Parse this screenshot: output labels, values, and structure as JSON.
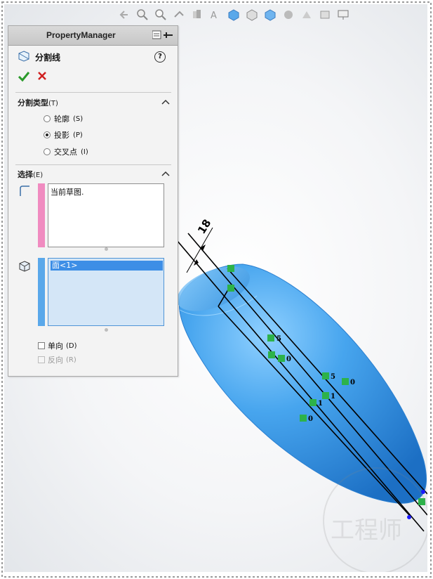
{
  "property_manager": {
    "title": "PropertyManager",
    "feature_name": "分割线",
    "help": "?",
    "sections": {
      "split_type": {
        "title": "分割类型",
        "hotkey": "(T)",
        "options": [
          {
            "label": "轮廓",
            "hotkey": "(S)",
            "selected": false
          },
          {
            "label": "投影",
            "hotkey": "(P)",
            "selected": true
          },
          {
            "label": "交叉点",
            "hotkey": "(I)",
            "selected": false
          }
        ]
      },
      "selection": {
        "title": "选择",
        "hotkey": "(E)",
        "sketch_box_text": "当前草图.",
        "face_box_item": "面<1>",
        "single_direction": {
          "label": "单向",
          "hotkey": "(D)",
          "checked": false
        },
        "reverse_direction": {
          "label": "反向",
          "hotkey": "(R)",
          "checked": false
        }
      }
    }
  },
  "viewport": {
    "dimension_value": "18",
    "relation_labels": [
      "5",
      "0",
      "5",
      "0",
      "1",
      "1",
      "0"
    ],
    "watermark": "工程师"
  },
  "colors": {
    "model_blue": "#3e9fe8",
    "relation_green": "#2db24a",
    "sketch_box_bar": "#f08bc0",
    "face_box_bar": "#5aa8ea"
  }
}
